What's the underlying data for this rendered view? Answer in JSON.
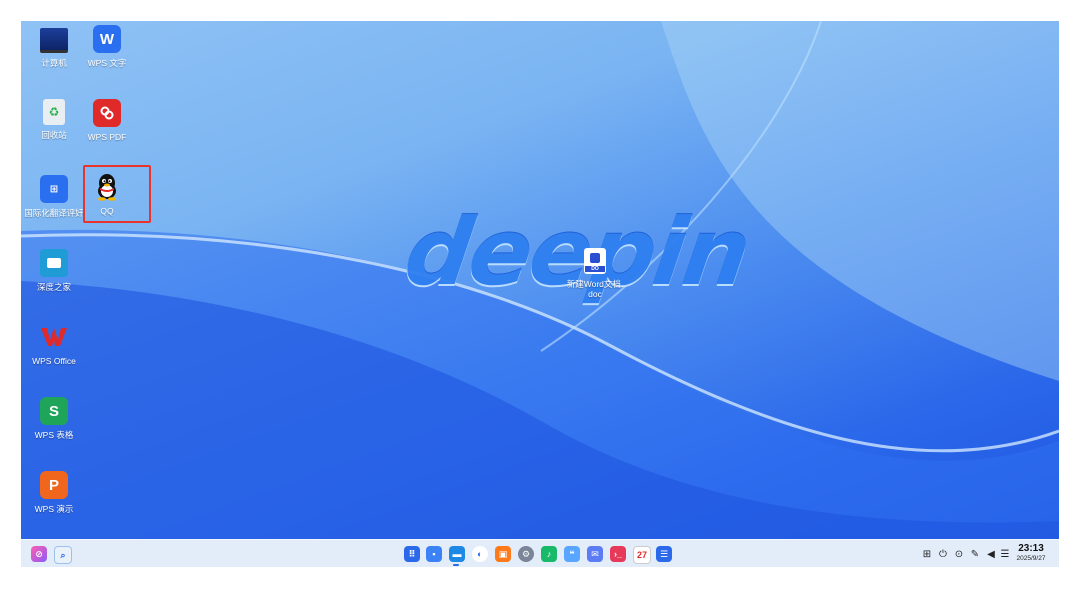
{
  "wallpaper": {
    "logo_text": "deepin"
  },
  "desktop_icons": [
    {
      "label": "计算机",
      "icon": "computer-icon"
    },
    {
      "label": "WPS 文字",
      "icon": "wps-writer-icon"
    },
    {
      "label": "回收站",
      "icon": "trash-icon"
    },
    {
      "label": "WPS PDF",
      "icon": "wps-pdf-icon"
    },
    {
      "label": "国际化翻译评奸",
      "icon": "translator-icon"
    },
    {
      "label": "QQ",
      "icon": "qq-penguin-icon"
    },
    {
      "label": "深度之家",
      "icon": "deepin-home-icon"
    },
    {
      "label": "WPS Office",
      "icon": "wps-office-icon"
    },
    {
      "label": "WPS 表格",
      "icon": "wps-spreadsheet-icon"
    },
    {
      "label": "WPS 演示",
      "icon": "wps-presentation-icon"
    },
    {
      "label": "新建Word文档.doc",
      "icon": "word-document-icon"
    }
  ],
  "icon_letters": {
    "writer": "W",
    "spreadsheet": "S",
    "presentation": "P",
    "doc_badge": "DO"
  },
  "taskbar": {
    "left_apps": [
      "launcher-icon",
      "search-icon"
    ],
    "center_apps": [
      "multitask-view-icon",
      "workspace-icon",
      "file-manager-icon",
      "browser-icon",
      "app-store-icon",
      "settings-icon",
      "music-icon",
      "notes-icon",
      "mail-icon",
      "terminal-icon",
      "calendar-icon",
      "contacts-icon"
    ],
    "calendar_day": "27",
    "tray": [
      "keyboard-icon",
      "power-icon",
      "notification-icon",
      "pen-icon",
      "volume-icon",
      "network-icon"
    ],
    "time": "23:13",
    "date": "2025/9/27"
  },
  "colors": {
    "selection_border": "#e8342a",
    "accent": "#2b68ea"
  }
}
